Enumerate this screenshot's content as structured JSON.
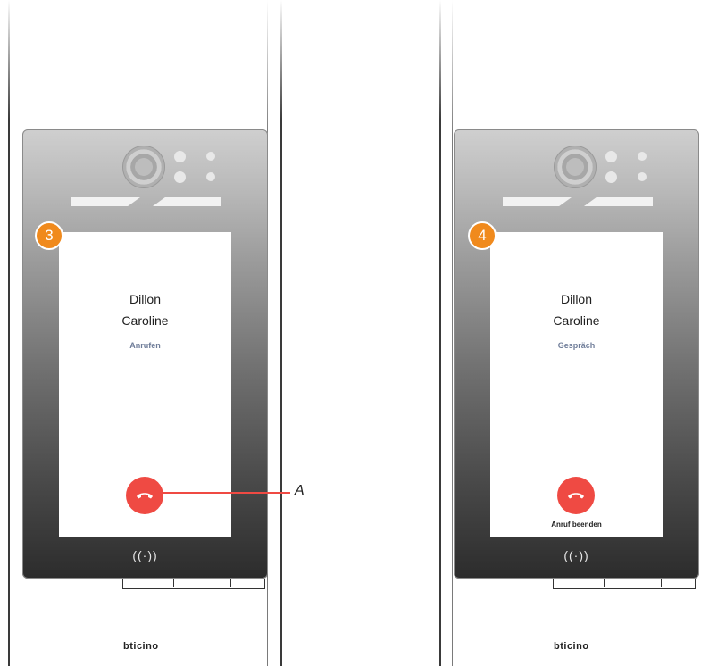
{
  "panels": [
    {
      "step": "3",
      "first_name": "Dillon",
      "last_name": "Caroline",
      "status": "Anrufen",
      "end_label": "",
      "nfc_symbol": "((·))",
      "logo": "bticino"
    },
    {
      "step": "4",
      "first_name": "Dillon",
      "last_name": "Caroline",
      "status": "Gespräch",
      "end_label": "Anruf beenden",
      "nfc_symbol": "((·))",
      "logo": "bticino"
    }
  ],
  "callout": {
    "label": "A"
  },
  "icons": {
    "end_call": "phone-hangup-icon",
    "nfc": "nfc-reader-icon",
    "camera": "camera-lens-icon"
  },
  "colors": {
    "end_call": "#ef4a43",
    "step_badge": "#f08a1d",
    "status_text": "#6f7d99"
  }
}
